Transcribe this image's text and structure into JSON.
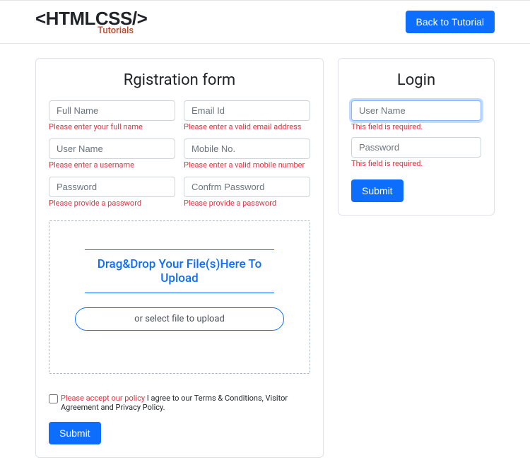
{
  "header": {
    "logo_main": "<HTMLCSS/>",
    "logo_sub": "Tutorials",
    "back_button": "Back to Tutorial"
  },
  "registration": {
    "title": "Rgistration form",
    "fields": {
      "fullname": {
        "placeholder": "Full Name",
        "error": "Please enter your full name "
      },
      "email": {
        "placeholder": "Email Id",
        "error": "Please enter a valid email address"
      },
      "username": {
        "placeholder": "User Name",
        "error": "Please enter a username"
      },
      "mobile": {
        "placeholder": "Mobile No.",
        "error": "Please enter a valid mobile number"
      },
      "password": {
        "placeholder": "Password",
        "error": "Please provide a password"
      },
      "confirm": {
        "placeholder": "Confrm Password",
        "error": "Please provide a password"
      }
    },
    "dropzone": {
      "heading": "Drag&Drop Your File(s)Here To Upload",
      "select": "or select file to upload"
    },
    "policy": {
      "error": "Please accept our policy",
      "text": " I agree to our Terms & Conditions, Visitor Agreement and Privacy Policy."
    },
    "submit": "Submit"
  },
  "login": {
    "title": "Login",
    "fields": {
      "username": {
        "placeholder": "User Name",
        "error": "This field is required."
      },
      "password": {
        "placeholder": "Password",
        "error": "This field is required."
      }
    },
    "submit": "Submit"
  }
}
